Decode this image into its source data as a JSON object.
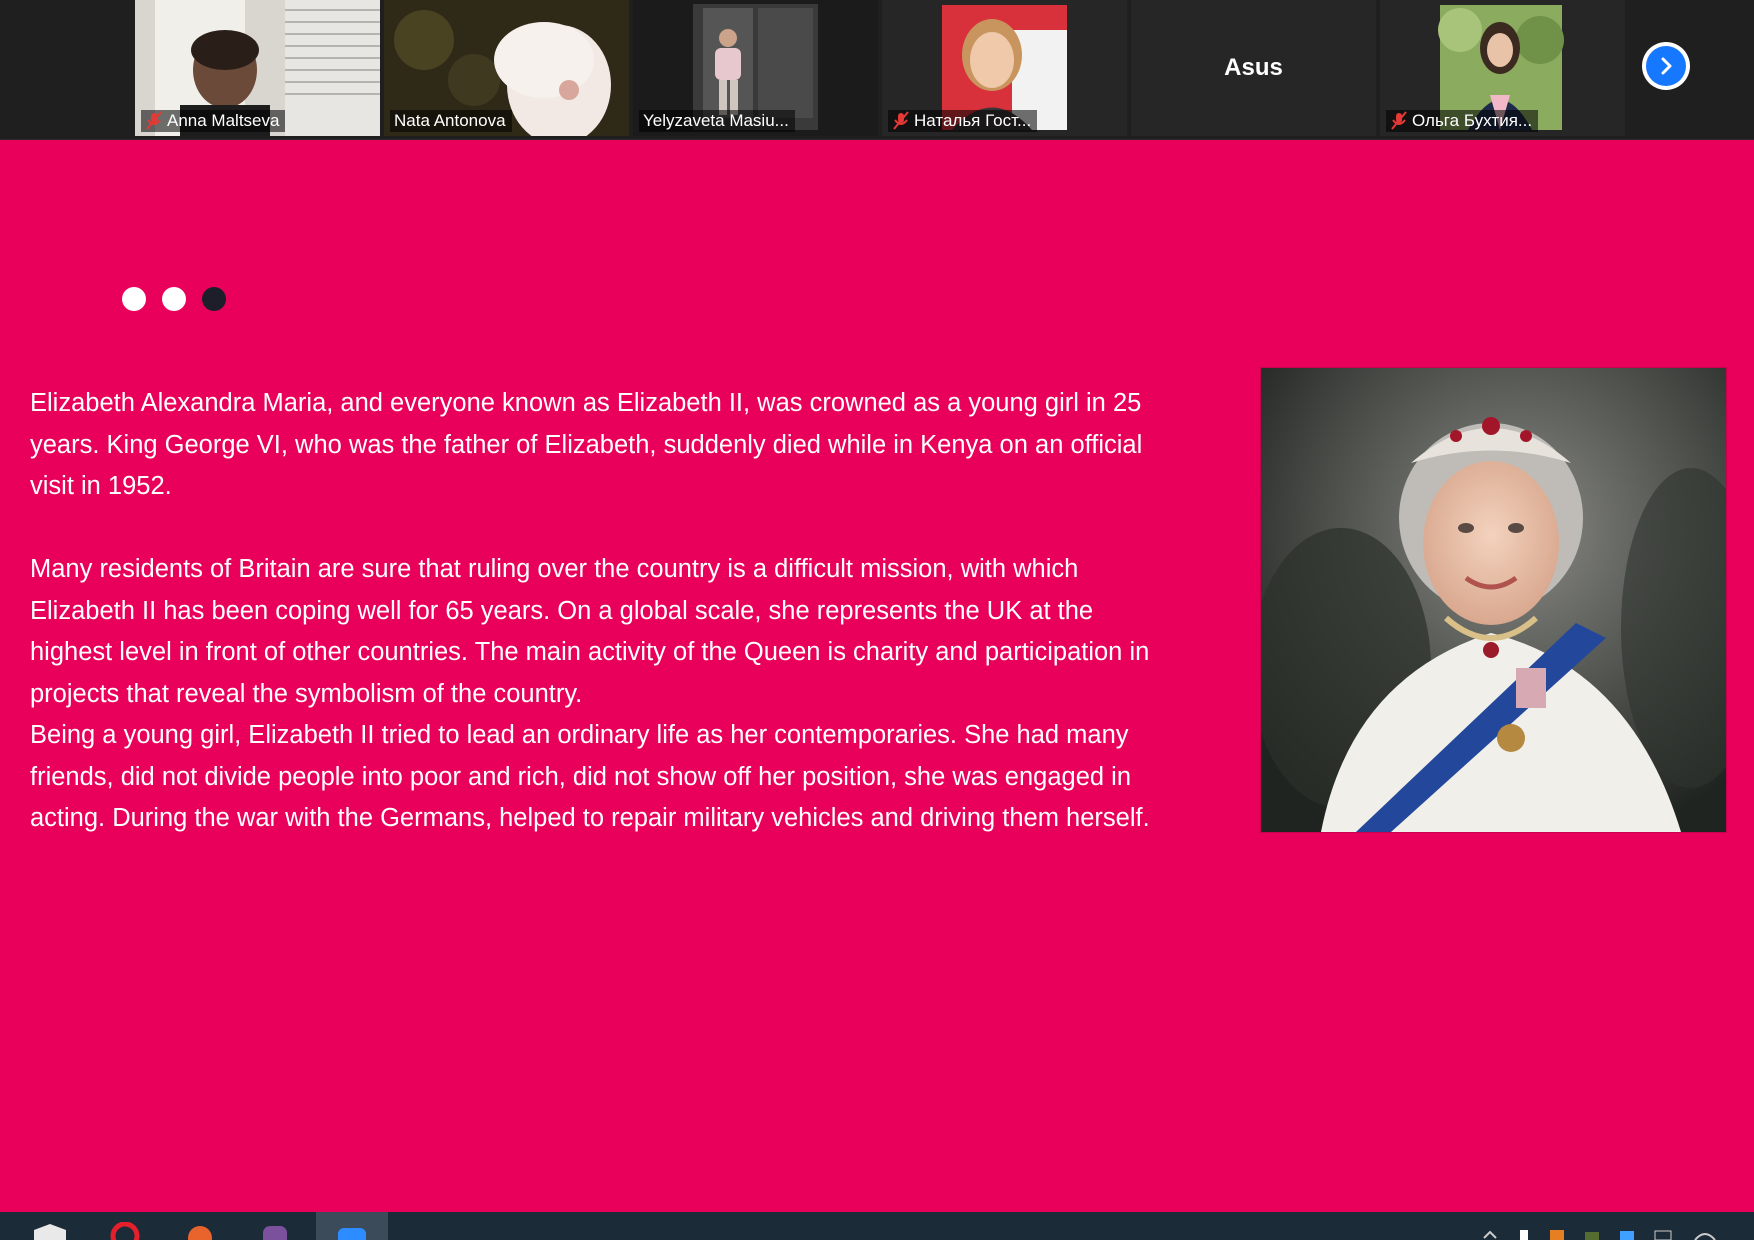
{
  "participants": [
    {
      "name": "Anna Maltseva",
      "muted": true
    },
    {
      "name": "Nata Antonova",
      "muted": false
    },
    {
      "name": "Yelyzaveta Masiu...",
      "muted": false,
      "active": true
    },
    {
      "name": "Наталья Гост...",
      "muted": true
    },
    {
      "name": "Asus",
      "video": false
    },
    {
      "name": "Ольга Бухтия...",
      "muted": true
    }
  ],
  "controls": {
    "next_icon": "chevron-right-icon"
  },
  "slide": {
    "background": "#e8005a",
    "dots": [
      {
        "color": "#ffffff"
      },
      {
        "color": "#ffffff"
      },
      {
        "color": "#1e1e2a"
      }
    ],
    "paragraphs": [
      "Elizabeth Alexandra Maria, and everyone known as Elizabeth II, was crowned as a young girl in 25 years. King George VI, who was the father of Elizabeth, suddenly died while in Kenya on an official visit in 1952.",
      "Many residents of Britain are sure that ruling over the country is a difficult mission, with which Elizabeth II has been coping well for 65 years. On a global scale,  she represents the UK at the highest level in front of other countries. The main activity of the Queen is charity and participation in projects that reveal the symbolism of the country.",
      "Being a young girl, Elizabeth II tried to lead an ordinary life as her contemporaries. She had many friends, did not divide people into poor and rich, did not show off her position, she was engaged in acting. During the war with the Germans, helped to repair military vehicles and driving them herself."
    ]
  },
  "taskbar": {
    "icons": [
      "file-explorer-icon",
      "opera-browser-icon",
      "office-app-icon",
      "viber-icon",
      "zoom-icon"
    ]
  }
}
